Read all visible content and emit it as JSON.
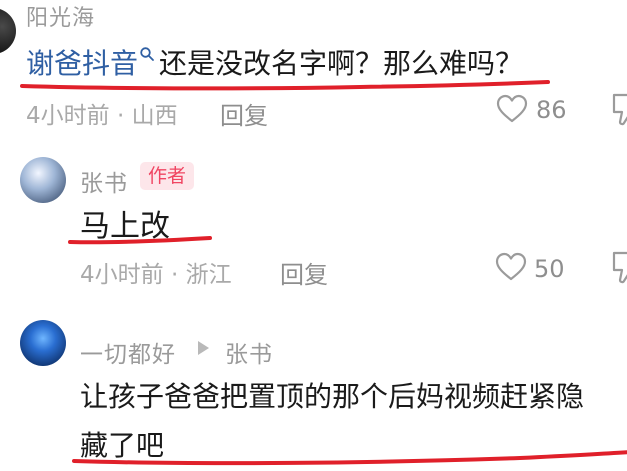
{
  "comments": [
    {
      "username": "阳光海",
      "mention": "谢爸抖音",
      "text": "还是没改名字啊？那么难吗？",
      "meta": "4小时前 · 山西",
      "reply_label": "回复",
      "likes": "86"
    },
    {
      "username": "张书",
      "badge": "作者",
      "text": "马上改",
      "meta": "4小时前 · 浙江",
      "reply_label": "回复",
      "likes": "50"
    },
    {
      "username": "一切都好",
      "reply_to": "张书",
      "text_line1": "让孩子爸爸把置顶的那个后妈视频赶紧隐",
      "text_line2": "藏了吧"
    }
  ],
  "colors": {
    "mention_link": "#2f5fa3",
    "author_badge_text": "#f04562",
    "author_badge_bg": "#fde6ea",
    "ink_underline": "#e0202a"
  },
  "icons": [
    "search-icon",
    "heart-icon",
    "dislike-icon",
    "reply-arrow-icon"
  ]
}
